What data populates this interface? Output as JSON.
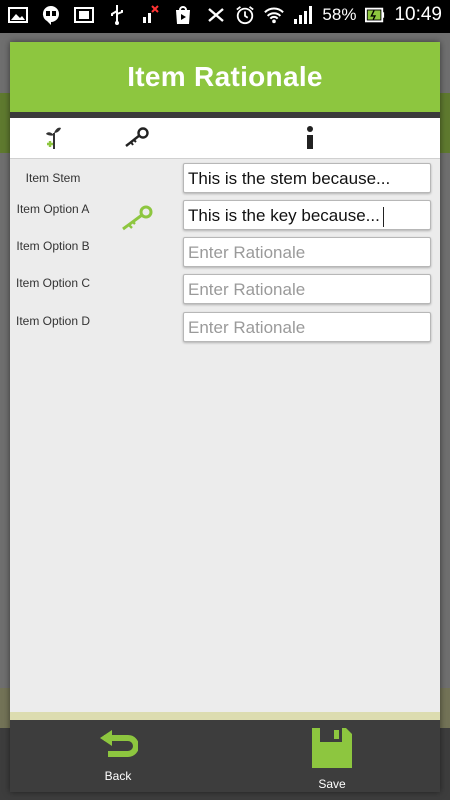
{
  "status_bar": {
    "battery_percent": "58%",
    "time": "10:49",
    "left_icons": [
      "image-icon",
      "hangouts-icon",
      "sim-icon",
      "usb-icon",
      "signal-error-icon",
      "play-store-icon"
    ],
    "right_icons": [
      "bluetooth-icon",
      "alarm-icon",
      "wifi-icon",
      "signal-icon",
      "battery-icon"
    ]
  },
  "dialog": {
    "title": "Item Rationale",
    "header_color": "#8dc63f",
    "column_icons": [
      "seedling-plus-icon",
      "key-icon",
      "info-icon"
    ],
    "rows": [
      {
        "label": "Item Stem",
        "value": "This is the stem because...",
        "placeholder": "",
        "is_key": false
      },
      {
        "label": "Item Option A",
        "value": "This is the key because...",
        "placeholder": "",
        "is_key": true
      },
      {
        "label": "Item Option B",
        "value": "",
        "placeholder": "Enter Rationale",
        "is_key": false
      },
      {
        "label": "Item Option C",
        "value": "",
        "placeholder": "Enter Rationale",
        "is_key": false
      },
      {
        "label": "Item Option D",
        "value": "",
        "placeholder": "Enter Rationale",
        "is_key": false
      }
    ]
  },
  "footer": {
    "back_label": "Back",
    "save_label": "Save"
  }
}
